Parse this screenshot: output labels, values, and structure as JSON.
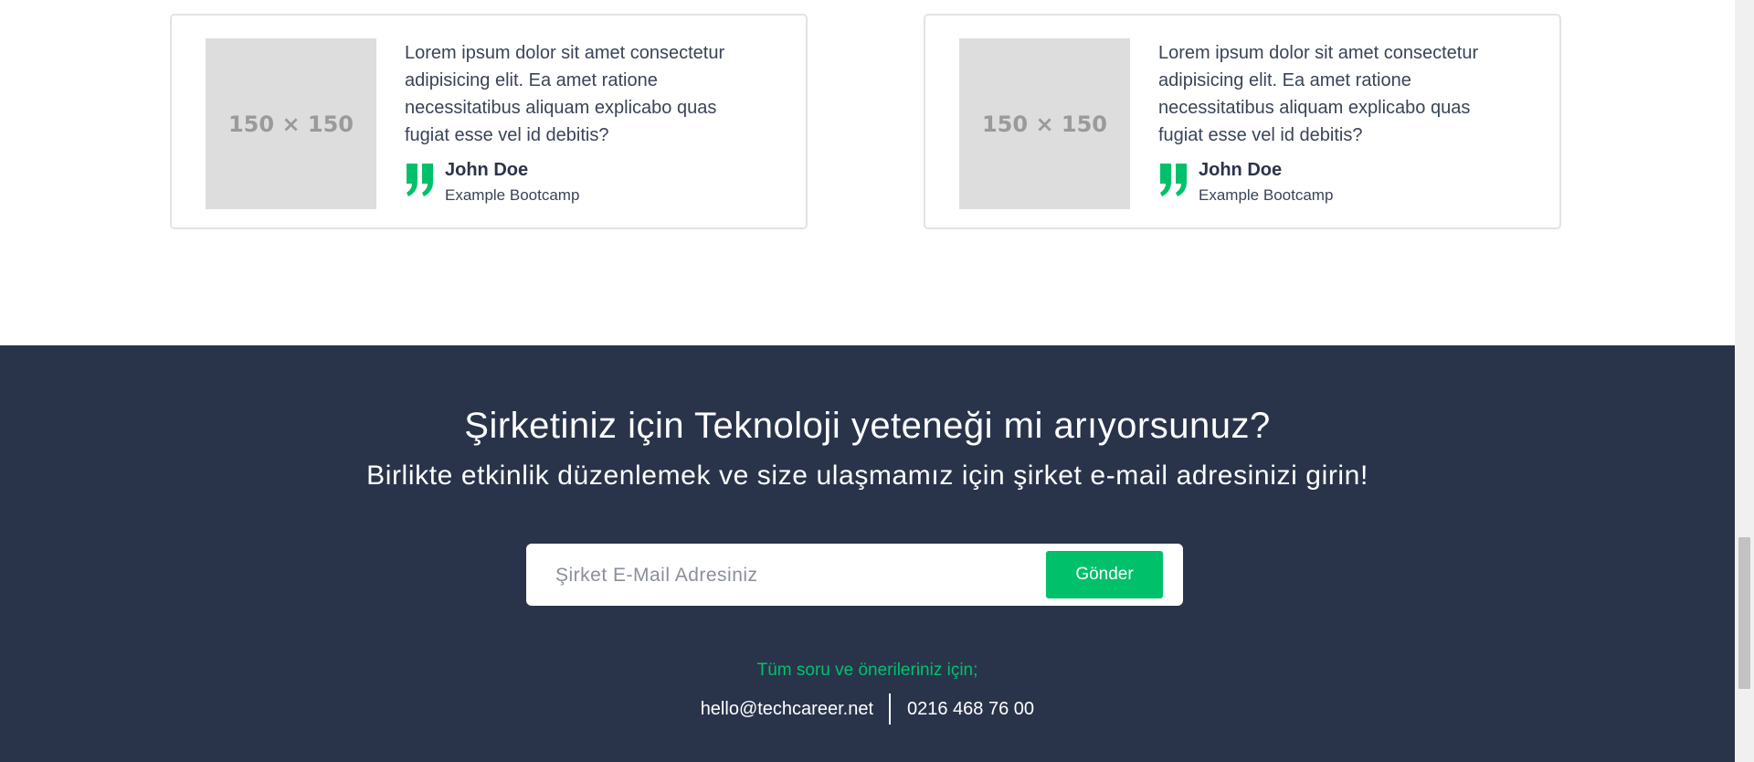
{
  "testimonials": [
    {
      "image_label": "150 × 150",
      "quote": "Lorem ipsum dolor sit amet consectetur adipisicing elit. Ea amet ratione necessitatibus aliquam explicabo quas fugiat esse vel id debitis?",
      "author": "John Doe",
      "organization": "Example Bootcamp"
    },
    {
      "image_label": "150 × 150",
      "quote": "Lorem ipsum dolor sit amet consectetur adipisicing elit. Ea amet ratione necessitatibus aliquam explicabo quas fugiat esse vel id debitis?",
      "author": "John Doe",
      "organization": "Example Bootcamp"
    }
  ],
  "cta": {
    "title": "Şirketiniz için Teknoloji yeteneği mi arıyorsunuz?",
    "subtitle": "Birlikte etkinlik düzenlemek ve size ulaşmamız için şirket e-mail adresinizi girin!",
    "email_placeholder": "Şirket E-Mail Adresiniz",
    "email_value": "",
    "submit_label": "Gönder",
    "contact_label": "Tüm soru ve önerileriniz için;",
    "contact_email": "hello@techcareer.net",
    "contact_phone": "0216 468 76 00"
  },
  "colors": {
    "accent": "#00c16a",
    "footer_bg": "#29344b",
    "text": "#3a4456"
  },
  "icons": [
    "quote-icon"
  ]
}
